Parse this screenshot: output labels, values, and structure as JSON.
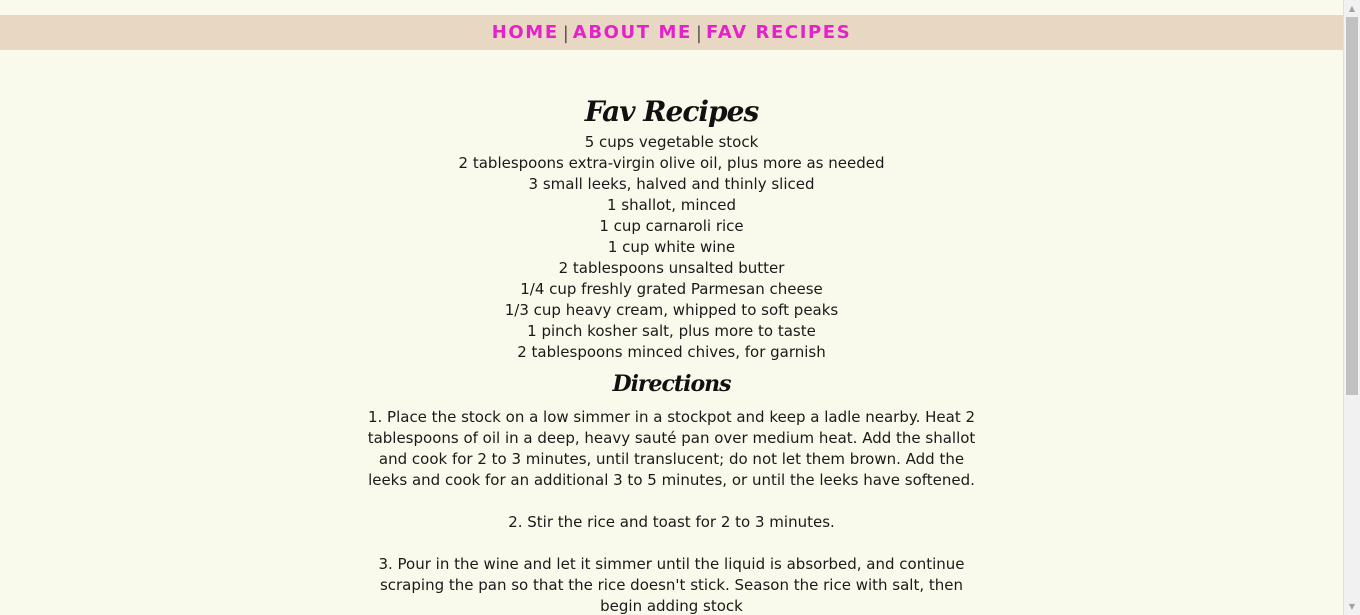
{
  "nav": {
    "home": "HOME",
    "about": "ABOUT ME",
    "recipes": "FAV RECIPES",
    "separator": "|"
  },
  "main": {
    "title": "Fav Recipes",
    "ingredients": [
      "5 cups vegetable stock",
      "2 tablespoons extra-virgin olive oil, plus more as needed",
      "3 small leeks, halved and thinly sliced",
      "1 shallot, minced",
      "1 cup carnaroli rice",
      "1 cup white wine",
      "2 tablespoons unsalted butter",
      "1/4 cup freshly grated Parmesan cheese",
      "1/3 cup heavy cream, whipped to soft peaks",
      "1 pinch kosher salt, plus more to taste",
      "2 tablespoons minced chives, for garnish"
    ],
    "directions_heading": "Directions",
    "steps": [
      "1. Place the stock on a low simmer in a stockpot and keep a ladle nearby. Heat 2 tablespoons of oil in a deep, heavy sauté pan over medium heat. Add the shallot and cook for 2 to 3 minutes, until translucent; do not let them brown. Add the leeks and cook for an additional 3 to 5 minutes, or until the leeks have softened.",
      "2. Stir the rice and toast for 2 to 3 minutes.",
      "3. Pour in the wine and let it simmer until the liquid is absorbed, and continue scraping the pan so that the rice doesn't stick. Season the rice with salt, then begin adding stock"
    ]
  },
  "colors": {
    "nav_link": "#e323c8",
    "nav_bar": "#e8d8c3",
    "page_background": "#fafaec"
  },
  "icons": {
    "scroll_up": "scroll-up-arrow-icon",
    "scroll_down": "scroll-down-arrow-icon"
  }
}
